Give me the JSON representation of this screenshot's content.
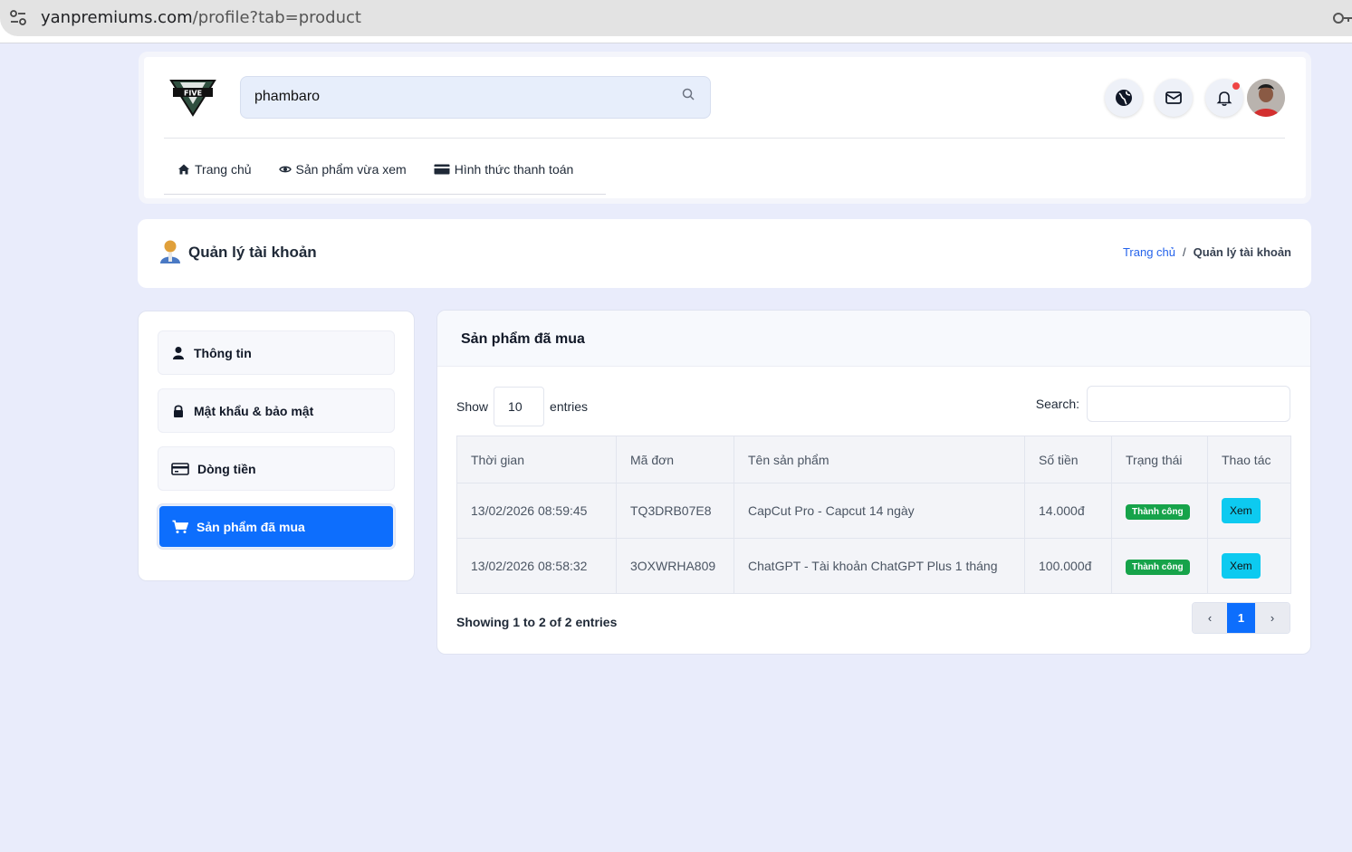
{
  "browser": {
    "url_host": "yanpremiums.com",
    "url_path": "/profile?tab=product"
  },
  "header": {
    "logo_alt": "FIVE",
    "search_value": "phambaro",
    "nav": [
      {
        "label": "Trang chủ",
        "icon": "home-icon"
      },
      {
        "label": "Sản phẩm vừa xem",
        "icon": "eye-icon"
      },
      {
        "label": "Hình thức thanh toán",
        "icon": "credit-card-icon"
      }
    ],
    "icons": [
      "globe-icon",
      "mail-icon",
      "bell-icon"
    ]
  },
  "page": {
    "title": "Quản lý tài khoản",
    "breadcrumb": {
      "home": "Trang chủ",
      "sep": "/",
      "current": "Quản lý tài khoản"
    }
  },
  "sidebar": {
    "items": [
      {
        "label": "Thông tin",
        "icon": "user-icon",
        "active": false
      },
      {
        "label": "Mật khẩu & bảo mật",
        "icon": "lock-icon",
        "active": false
      },
      {
        "label": "Dòng tiền",
        "icon": "wallet-icon",
        "active": false
      },
      {
        "label": "Sản phẩm đã mua",
        "icon": "cart-icon",
        "active": true
      }
    ]
  },
  "main": {
    "heading": "Sản phẩm đã mua",
    "length": {
      "show": "Show",
      "value": "10",
      "entries": "entries"
    },
    "search_label": "Search:",
    "columns": [
      "Thời gian",
      "Mã đơn",
      "Tên sản phẩm",
      "Số tiền",
      "Trạng thái",
      "Thao tác"
    ],
    "rows": [
      {
        "time": "13/02/2026 08:59:45",
        "code": "TQ3DRB07E8",
        "product": "CapCut Pro - Capcut 14 ngày",
        "amount": "14.000đ",
        "status": "Thành công",
        "action": "Xem"
      },
      {
        "time": "13/02/2026 08:58:32",
        "code": "3OXWRHA809",
        "product": "ChatGPT - Tài khoản ChatGPT Plus 1 tháng",
        "amount": "100.000đ",
        "status": "Thành công",
        "action": "Xem"
      }
    ],
    "info": "Showing 1 to 2 of 2 entries",
    "pager": {
      "prev": "‹",
      "page": "1",
      "next": "›"
    }
  },
  "colors": {
    "primary": "#0d6efd",
    "success": "#16a34a",
    "info": "#0dcaf0",
    "page_bg": "#e9ecfb"
  }
}
